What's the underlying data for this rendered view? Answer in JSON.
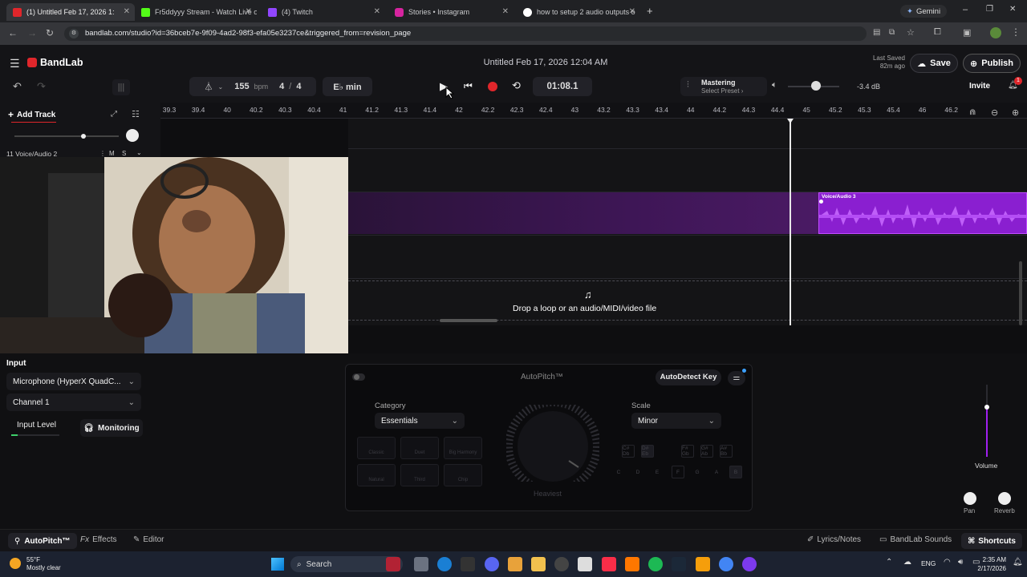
{
  "browser": {
    "tabs": [
      {
        "label": "(1) Untitled Feb 17, 2026 1:",
        "active": true
      },
      {
        "label": "Fr5ddyyy Stream - Watch Live o",
        "active": false
      },
      {
        "label": "(4) Twitch",
        "active": false
      },
      {
        "label": "Stories • Instagram",
        "active": false
      },
      {
        "label": "how to setup 2 audio outputs o",
        "active": false
      }
    ],
    "gemini_label": "Gemini",
    "url": "bandlab.com/studio?id=36bceb7e-9f09-4ad2-98f3-efa05e3237ce&triggered_from=revision_page"
  },
  "app": {
    "logo": "BandLab",
    "project_title": "Untitled Feb 17, 2026 12:04 AM",
    "last_saved_label": "Last Saved",
    "last_saved_time": "82m ago",
    "save_label": "Save",
    "publish_label": "Publish",
    "invite_label": "Invite",
    "notification_count": "1"
  },
  "transport": {
    "tempo": "155",
    "tempo_unit": "bpm",
    "time_signature_num": "4",
    "time_signature_sep": "/",
    "time_signature_den": "4",
    "key": "E♭ min",
    "time": "01:08.1"
  },
  "mastering": {
    "label": "Mastering",
    "preset": "Select Preset ›",
    "volume_db": "-3.4 dB"
  },
  "tracks": {
    "add_track_label": "Add Track",
    "track_name": "11  Voice/Audio 2",
    "track_mute": "M",
    "track_solo": "S",
    "clip_name": "Voice/Audio 3",
    "drop_text": "Drop a loop or an audio/MIDI/video file"
  },
  "ruler": [
    "39.3",
    "39.4",
    "40",
    "40.2",
    "40.3",
    "40.4",
    "41",
    "41.2",
    "41.3",
    "41.4",
    "42",
    "42.2",
    "42.3",
    "42.4",
    "43",
    "43.2",
    "43.3",
    "43.4",
    "44",
    "44.2",
    "44.3",
    "44.4",
    "45",
    "45.2",
    "45.3",
    "45.4",
    "46",
    "46.2"
  ],
  "input_panel": {
    "input_label": "Input",
    "microphone": "Microphone (HyperX QuadC...",
    "channel": "Channel 1",
    "input_level_label": "Input Level",
    "monitoring_label": "Monitoring"
  },
  "autopitch": {
    "title": "AutoPitch™",
    "autodetect_label": "AutoDetect Key",
    "category_label": "Category",
    "category_value": "Essentials",
    "scale_label": "Scale",
    "scale_value": "Minor",
    "knob_label": "Heaviest",
    "presets": [
      "Classic",
      "Duet",
      "Big Harmony",
      "Natural",
      "Third",
      "Chip"
    ],
    "sharp_keys": [
      "C#\nDb",
      "D#\nEb",
      "F#\nGb",
      "G#\nAb",
      "A#\nBb"
    ],
    "natural_keys": [
      "C",
      "D",
      "E",
      "F",
      "G",
      "A",
      "B"
    ]
  },
  "mixer": {
    "volume_label": "Volume",
    "pan_label": "Pan",
    "reverb_label": "Reverb"
  },
  "footer_tabs": {
    "autopitch": "AutoPitch™",
    "effects": "Effects",
    "editor": "Editor",
    "lyrics": "Lyrics/Notes",
    "sounds": "BandLab Sounds",
    "shortcuts": "Shortcuts"
  },
  "taskbar": {
    "weather_temp": "55°F",
    "weather_desc": "Mostly clear",
    "search": "Search",
    "lang": "ENG",
    "time": "2:35 AM",
    "date": "2/17/2026"
  },
  "colors": {
    "accent_red": "#e0262b",
    "clip_purple": "#8a1fd0",
    "publish_bg": "#1d1d22"
  }
}
